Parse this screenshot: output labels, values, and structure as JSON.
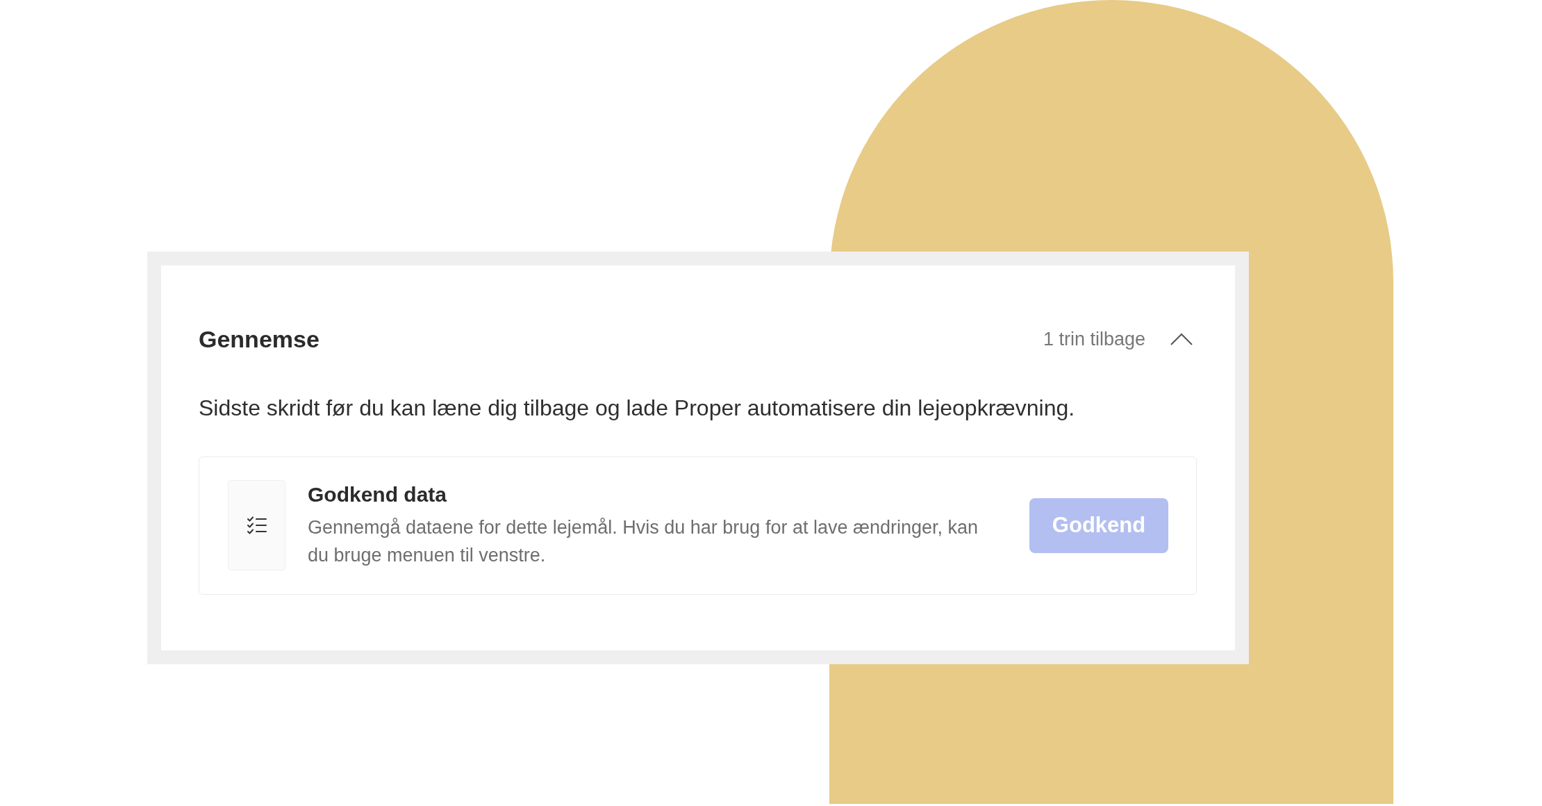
{
  "review_panel": {
    "title": "Gennemse",
    "back_link": "1 trin tilbage",
    "expanded": true,
    "intro": "Sidste skridt før du kan læne dig tilbage og lade Proper automatisere din lejeopkrævning.",
    "tasks": [
      {
        "title": "Godkend data",
        "description": "Gennemgå dataene for dette lejemål. Hvis du har brug for at lave ændringer, kan du bruge menuen til venstre.",
        "button": {
          "label": "Godkend",
          "disabled": true
        }
      }
    ]
  }
}
